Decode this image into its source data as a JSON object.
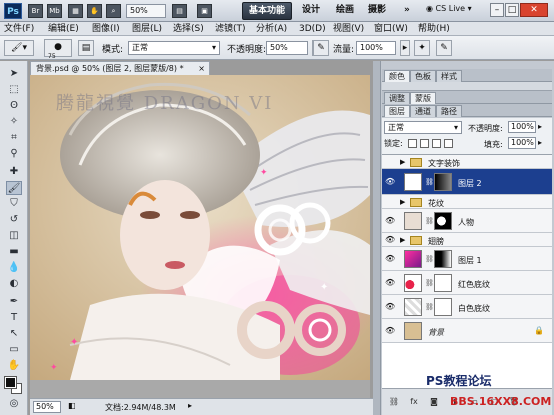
{
  "app": {
    "logo": "Ps",
    "zoom": "50%",
    "workspaces": [
      "基本功能",
      "设计",
      "绘画",
      "摄影"
    ],
    "cs_live": "CS Live",
    "icons": [
      "br-icon",
      "mb-icon"
    ]
  },
  "menu": [
    "文件(F)",
    "编辑(E)",
    "图像(I)",
    "图层(L)",
    "选择(S)",
    "滤镜(T)",
    "分析(A)",
    "3D(D)",
    "视图(V)",
    "窗口(W)",
    "帮助(H)"
  ],
  "options": {
    "brush_size": "75",
    "mode_label": "模式:",
    "mode_value": "正常",
    "opacity_label": "不透明度:",
    "opacity_value": "50%",
    "flow_label": "流量:",
    "flow_value": "100%"
  },
  "document": {
    "tab_title": "背景.psd @ 50% (图层 2, 图层蒙版/8) *",
    "watermark": "腾龍視覺 DRAGON VI",
    "status_zoom": "50%",
    "status_info": "文档:2.94M/48.3M"
  },
  "panels": {
    "row1": [
      "颜色",
      "色板",
      "样式"
    ],
    "row2": [
      "调整",
      "蒙版"
    ],
    "row3": [
      "图层",
      "通道",
      "路径"
    ]
  },
  "layers_panel": {
    "blend_mode": "正常",
    "opacity_label": "不透明度:",
    "opacity_value": "100%",
    "lock_label": "锁定:",
    "fill_label": "填充:",
    "fill_value": "100%",
    "layers": [
      {
        "name": "文字装饰",
        "type": "group",
        "visible": false
      },
      {
        "name": "图层 2",
        "type": "layer-mask",
        "visible": true,
        "selected": true
      },
      {
        "name": "花纹",
        "type": "group",
        "visible": false
      },
      {
        "name": "人物",
        "type": "layer-mask",
        "visible": true
      },
      {
        "name": "翅膀",
        "type": "group",
        "visible": true
      },
      {
        "name": "图层 1",
        "type": "layer-mask",
        "visible": true
      },
      {
        "name": "红色底纹",
        "type": "layer-mask",
        "visible": true
      },
      {
        "name": "白色底纹",
        "type": "layer-mask",
        "visible": true
      },
      {
        "name": "背景",
        "type": "background",
        "visible": true,
        "locked": true
      }
    ]
  },
  "watermark_bottom": {
    "line1": "PS教程论坛",
    "line2": "BBS.16XX8.COM"
  }
}
